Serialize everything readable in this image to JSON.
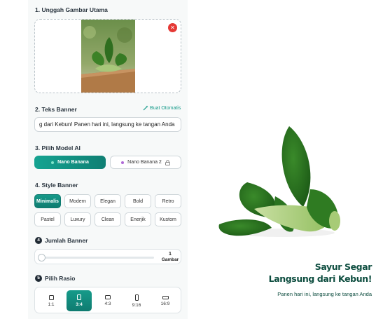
{
  "form": {
    "section1_title": "1. Unggah Gambar Utama",
    "section2_title": "2. Teks Banner",
    "auto_generate_label": "Buat Otomatis",
    "banner_text_value": "g dari Kebun! Panen hari ini, langsung ke tangan Anda",
    "section3_title": "3. Pilih Model AI",
    "models": [
      {
        "label": "Nano Banana",
        "selected": true
      },
      {
        "label": "Nano Banana 2",
        "selected": false,
        "locked": true
      }
    ],
    "section4_title": "4. Style Banner",
    "styles": [
      "Minimalis",
      "Modern",
      "Elegan",
      "Bold",
      "Retro",
      "Pastel",
      "Luxury",
      "Clean",
      "Enerjik",
      "Kustom"
    ],
    "selected_style": "Minimalis",
    "section5_step": "4",
    "section5_title": "Jumlah Banner",
    "banner_count_value": "1",
    "banner_count_unit": "Gambar",
    "section6_step": "5",
    "section6_title": "Pilih Rasio",
    "ratios": [
      "1:1",
      "3:4",
      "4:3",
      "9:16",
      "16:9"
    ],
    "selected_ratio": "3:4"
  },
  "preview": {
    "headline_line1": "Sayur Segar",
    "headline_line2": "Langsung dari Kebun!",
    "subtext": "Panen hari ini, langsung ke tangan Anda"
  },
  "colors": {
    "accent": "#169b8a",
    "danger": "#e53935",
    "banner_text": "#0d4d3f"
  },
  "icons": {
    "remove": "close-icon",
    "auto": "magic-wand-icon",
    "lock": "lock-icon"
  }
}
